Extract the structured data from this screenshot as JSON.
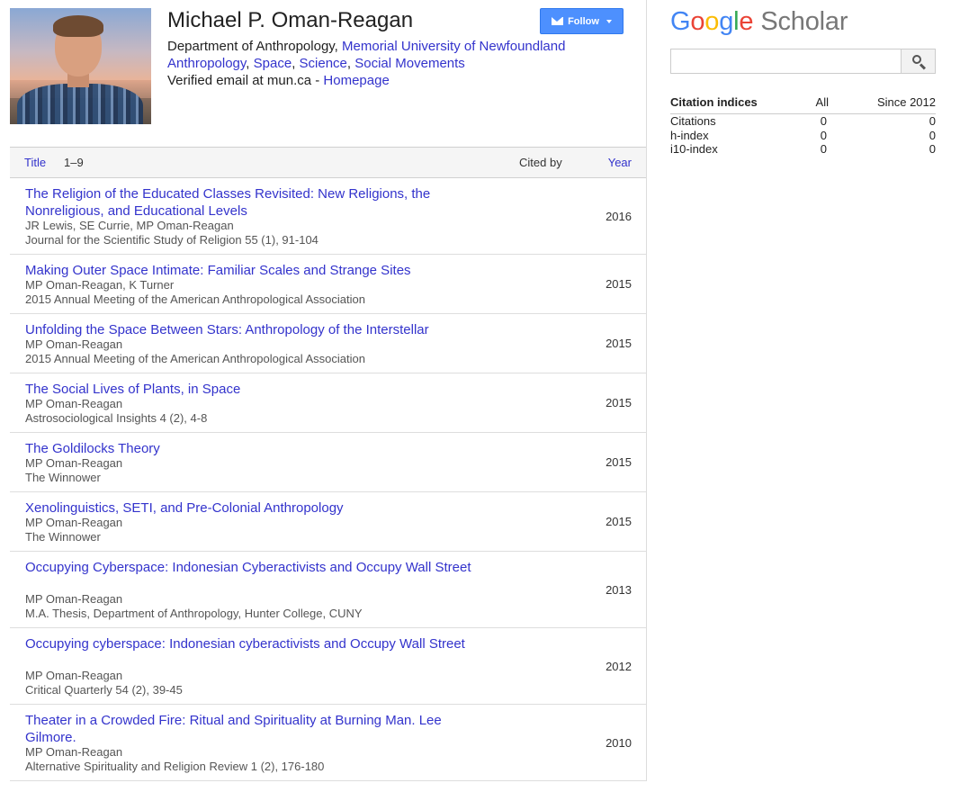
{
  "profile": {
    "name": "Michael P. Oman-Reagan",
    "department": "Department of Anthropology, ",
    "university": "Memorial University of Newfoundland",
    "interests": [
      "Anthropology",
      "Space",
      "Science",
      "Social Movements"
    ],
    "interest_separator": ", ",
    "verified_email": "Verified email at mun.ca - ",
    "homepage": "Homepage",
    "follow_label": "Follow"
  },
  "articles_table": {
    "title_header": "Title",
    "range": "1–9",
    "cited_by_header": "Cited by",
    "year_header": "Year",
    "rows": [
      {
        "title": "The Religion of the Educated Classes Revisited: New Religions, the Nonreligious, and Educational Levels",
        "authors": "JR Lewis, SE Currie, MP Oman-Reagan",
        "venue": "Journal for the Scientific Study of Religion 55 (1), 91-104",
        "year": "2016"
      },
      {
        "title": "Making Outer Space Intimate: Familiar Scales and Strange Sites",
        "authors": "MP Oman-Reagan, K Turner",
        "venue": "2015 Annual Meeting of the American Anthropological Association",
        "year": "2015"
      },
      {
        "title": "Unfolding the Space Between Stars: Anthropology of the Interstellar",
        "authors": "MP Oman-Reagan",
        "venue": "2015 Annual Meeting of the American Anthropological Association",
        "year": "2015"
      },
      {
        "title": "The Social Lives of Plants, in Space",
        "authors": "MP Oman-Reagan",
        "venue": "Astrosociological Insights 4 (2), 4-8",
        "year": "2015"
      },
      {
        "title": "The Goldilocks Theory",
        "authors": "MP Oman-Reagan",
        "venue": "The Winnower",
        "year": "2015"
      },
      {
        "title": "Xenolinguistics, SETI, and Pre-Colonial Anthropology",
        "authors": "MP Oman-Reagan",
        "venue": "The Winnower",
        "year": "2015"
      },
      {
        "title": "Occupying Cyberspace: Indonesian Cyberactivists and Occupy Wall Street",
        "authors": "MP Oman-Reagan",
        "venue": "M.A. Thesis, Department of Anthropology, Hunter College, CUNY",
        "year": "2013"
      },
      {
        "title": "Occupying cyberspace: Indonesian cyberactivists and Occupy Wall Street",
        "authors": "MP Oman-Reagan",
        "venue": "Critical Quarterly 54 (2), 39-45",
        "year": "2012"
      },
      {
        "title": "Theater in a Crowded Fire: Ritual and Spirituality at Burning Man. Lee Gilmore.",
        "authors": "MP Oman-Reagan",
        "venue": "Alternative Spirituality and Religion Review 1 (2), 176-180",
        "year": "2010"
      }
    ]
  },
  "scholar": {
    "logo_letters": [
      "G",
      "o",
      "o",
      "g",
      "l",
      "e"
    ],
    "logo_word": "Scholar",
    "search_value": "",
    "search_icon": "search-icon"
  },
  "citation_indices": {
    "header": "Citation indices",
    "col_all": "All",
    "col_since": "Since 2012",
    "rows": [
      {
        "label": "Citations",
        "all": "0",
        "since": "0"
      },
      {
        "label": "h-index",
        "all": "0",
        "since": "0"
      },
      {
        "label": "i10-index",
        "all": "0",
        "since": "0"
      }
    ]
  },
  "colors": {
    "link": "#3333cc",
    "follow_button": "#4d90fe",
    "google_blue": "#4285f4",
    "google_red": "#ea4335",
    "google_yellow": "#fbbc05",
    "google_green": "#34a853"
  }
}
